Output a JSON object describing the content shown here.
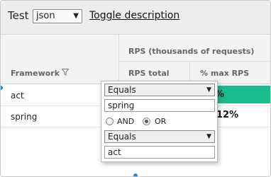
{
  "toolbar": {
    "test_label": "Test",
    "test_select_value": "json",
    "toggle_description_label": "Toggle description"
  },
  "table": {
    "group_header": "RPS (thousands of requests)",
    "column_framework": "Framework",
    "column_rps_total": "RPS total",
    "column_pct_max": "% max RPS",
    "rows": [
      {
        "framework": "act",
        "pct_max": "%"
      },
      {
        "framework": "spring",
        "pct_max": "12%"
      }
    ]
  },
  "filter_popup": {
    "condition1_operator": "Equals",
    "condition1_value": "spring",
    "join_and_label": "AND",
    "join_or_label": "OR",
    "join_selected": "OR",
    "condition2_operator": "Equals",
    "condition2_value": "act"
  },
  "colors": {
    "highlight_green": "#19bd8c",
    "selection_handle_blue": "#1e8ae6"
  },
  "icons": {
    "filter": "filter-icon",
    "dropdown": "chevron-down-icon"
  }
}
